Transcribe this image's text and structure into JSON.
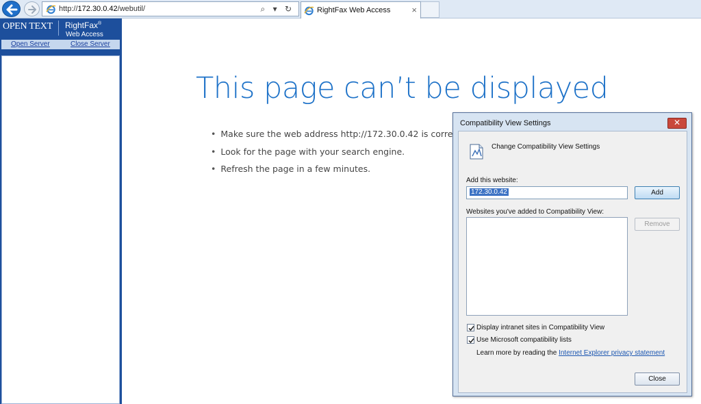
{
  "browser": {
    "address": {
      "scheme": "http://",
      "host": "172.30.0.42",
      "path": "/webutil/"
    },
    "tab": {
      "title": "RightFax Web Access",
      "close_glyph": "×"
    },
    "addr_tools": "⌕ ▾ ↻"
  },
  "leftframe": {
    "brand": {
      "opentext": "OPEN TEXT",
      "rightfax": "RightFax",
      "reg": "®",
      "webaccess": "Web Access"
    },
    "links": {
      "open_server": "Open Server",
      "close_server": "Close Server"
    }
  },
  "error_page": {
    "title": "This page can’t be displayed",
    "bullets": [
      "Make sure the web address http://172.30.0.42 is correct.",
      "Look for the page with your search engine.",
      "Refresh the page in a few minutes."
    ]
  },
  "dialog": {
    "title": "Compatibility View Settings",
    "close_glyph": "✕",
    "heading": "Change Compatibility View Settings",
    "add_label": "Add this website:",
    "add_value": "172.30.0.42",
    "add_button": "Add",
    "list_label": "Websites you've added to Compatibility View:",
    "remove_button": "Remove",
    "checkboxes": [
      {
        "label": "Display intranet sites in Compatibility View",
        "checked": true
      },
      {
        "label": "Use Microsoft compatibility lists",
        "checked": true
      }
    ],
    "learn_more": "Learn more by reading the",
    "privacy_link": "Internet Explorer privacy statement",
    "close_button": "Close"
  },
  "colors": {
    "title_blue": "#1e72c8",
    "frame_blue": "#1d4f9c",
    "dialog_frame": "#d7e4f2",
    "close_red": "#c9483b"
  }
}
